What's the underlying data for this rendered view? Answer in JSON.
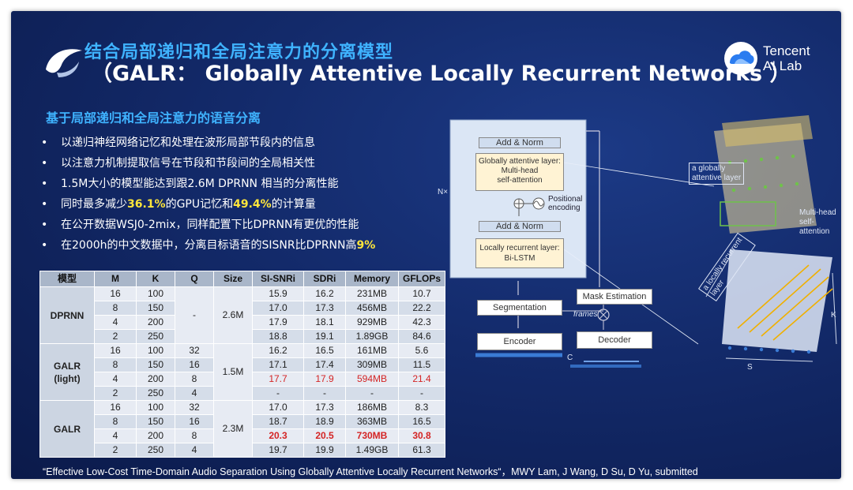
{
  "slide": {
    "title_cn": "结合局部递归和全局注意力的分离模型",
    "title_en": "（GALR：  Globally Attentive Locally Recurrent Networks ）",
    "brand_line1": "Tencent",
    "brand_line2": "AI Lab",
    "subtitle": "基于局部递归和全局注意力的语音分离",
    "bullet_char": "•",
    "bullets": [
      {
        "pre": "以递归神经网络记忆和处理在波形局部节段内的信息",
        "h1": "",
        "mid": "",
        "h2": "",
        "post": ""
      },
      {
        "pre": "以注意力机制提取信号在节段和节段间的全局相关性",
        "h1": "",
        "mid": "",
        "h2": "",
        "post": ""
      },
      {
        "pre": "1.5M大小的模型能达到跟2.6M DPRNN 相当的分离性能",
        "h1": "",
        "mid": "",
        "h2": "",
        "post": ""
      },
      {
        "pre": "同时最多减少",
        "h1": "36.1%",
        "mid": "的GPU记忆和",
        "h2": "49.4%",
        "post": "的计算量"
      },
      {
        "pre": "在公开数据WSJ0-2mix，同样配置下比DPRNN有更优的性能",
        "h1": "",
        "mid": "",
        "h2": "",
        "post": ""
      },
      {
        "pre": "在2000h的中文数据中，分离目标语音的SISNR比DPRNN高",
        "h1": "9%",
        "mid": "",
        "h2": "",
        "post": ""
      }
    ],
    "citation": "“Effective Low-Cost Time-Domain Audio Separation Using Globally Attentive Locally Recurrent Networks“，MWY Lam, J Wang, D Su, D Yu,  submitted"
  },
  "table": {
    "headers": [
      "模型",
      "M",
      "K",
      "Q",
      "Size",
      "SI-SNRi",
      "SDRi",
      "Memory",
      "GFLOPs"
    ],
    "groups": [
      {
        "model": "DPRNN",
        "q": "-",
        "size": "2.6M",
        "rows": [
          {
            "m": "16",
            "k": "100",
            "si": "15.9",
            "sdr": "16.2",
            "mem": "231MB",
            "gf": "10.7",
            "style": ""
          },
          {
            "m": "8",
            "k": "150",
            "si": "17.0",
            "sdr": "17.3",
            "mem": "456MB",
            "gf": "22.2",
            "style": ""
          },
          {
            "m": "4",
            "k": "200",
            "si": "17.9",
            "sdr": "18.1",
            "mem": "929MB",
            "gf": "42.3",
            "style": ""
          },
          {
            "m": "2",
            "k": "250",
            "si": "18.8",
            "sdr": "19.1",
            "mem": "1.89GB",
            "gf": "84.6",
            "style": ""
          }
        ]
      },
      {
        "model": "GALR\n(light)",
        "size": "1.5M",
        "rows": [
          {
            "m": "16",
            "k": "100",
            "q": "32",
            "si": "16.2",
            "sdr": "16.5",
            "mem": "161MB",
            "gf": "5.6",
            "style": ""
          },
          {
            "m": "8",
            "k": "150",
            "q": "16",
            "si": "17.1",
            "sdr": "17.4",
            "mem": "309MB",
            "gf": "11.5",
            "style": ""
          },
          {
            "m": "4",
            "k": "200",
            "q": "8",
            "si": "17.7",
            "sdr": "17.9",
            "mem": "594MB",
            "gf": "21.4",
            "style": "red"
          },
          {
            "m": "2",
            "k": "250",
            "q": "4",
            "si": "-",
            "sdr": "-",
            "mem": "-",
            "gf": "-",
            "style": ""
          }
        ]
      },
      {
        "model": "GALR",
        "size": "2.3M",
        "rows": [
          {
            "m": "16",
            "k": "100",
            "q": "32",
            "si": "17.0",
            "sdr": "17.3",
            "mem": "186MB",
            "gf": "8.3",
            "style": ""
          },
          {
            "m": "8",
            "k": "150",
            "q": "16",
            "si": "18.7",
            "sdr": "18.9",
            "mem": "363MB",
            "gf": "16.5",
            "style": ""
          },
          {
            "m": "4",
            "k": "200",
            "q": "8",
            "si": "20.3",
            "sdr": "20.5",
            "mem": "730MB",
            "gf": "30.8",
            "style": "red-bold"
          },
          {
            "m": "2",
            "k": "250",
            "q": "4",
            "si": "19.7",
            "sdr": "19.9",
            "mem": "1.49GB",
            "gf": "61.3",
            "style": ""
          }
        ]
      }
    ]
  },
  "diagram": {
    "add_norm_top": "Add & Norm",
    "global_layer": "Globally attentive layer:",
    "global_sub1": "Multi-head",
    "global_sub2": "self-attention",
    "positional1": "Positional",
    "positional2": "encoding",
    "add_norm_bottom": "Add & Norm",
    "local_layer": "Locally recurrent layer:",
    "local_sub": "Bi-LSTM",
    "nx": "N×",
    "mask_estimation": "Mask Estimation",
    "segmentation": "Segmentation",
    "frames": "frames",
    "encoder": "Encoder",
    "decoder": "Decoder",
    "c_label": "C",
    "global_callout1": "a globally",
    "global_callout2": "attentive layer",
    "multihead1": "Multi-head",
    "multihead2": "self-",
    "multihead3": "attention",
    "local_callout1": "a locally recurrent",
    "local_callout2": "layer",
    "k_label": "K",
    "s_label": "S"
  },
  "colors": {
    "accent": "#3fb3ff",
    "highlight": "#ffe63b",
    "red": "#d42424",
    "background": "#132a6a"
  }
}
